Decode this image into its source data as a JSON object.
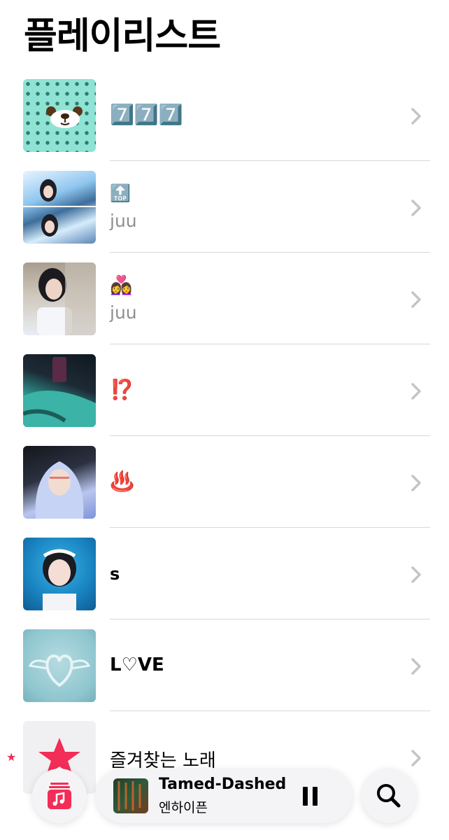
{
  "page_title": "플레이리스트",
  "playlists": [
    {
      "title": "7️⃣7️⃣7️⃣",
      "subtitle": "",
      "thumb": "bear-polka"
    },
    {
      "title": "🔝",
      "subtitle": "juu",
      "thumb": "girl-blue"
    },
    {
      "title": "👩‍❤️‍👩",
      "subtitle": "juu",
      "thumb": "girl-cap"
    },
    {
      "title": "⁉️",
      "subtitle": "",
      "thumb": "green-jacket"
    },
    {
      "title": "♨️",
      "subtitle": "",
      "thumb": "boy-hood"
    },
    {
      "title": "s",
      "subtitle": "",
      "thumb": "girl-pool"
    },
    {
      "title": "L♡VE",
      "subtitle": "",
      "thumb": "heart-plate"
    },
    {
      "title": "즐겨찾는 노래",
      "subtitle": "",
      "thumb": "star"
    }
  ],
  "now_playing": {
    "song": "Tamed-Dashed",
    "artist": "엔하이픈"
  },
  "icons": {
    "library": "music-note-stack-icon",
    "pause": "pause-icon",
    "search": "search-icon",
    "chevron": "chevron-right-icon"
  },
  "colors": {
    "accent": "#f22d57",
    "secondary_text": "#8e8e93"
  }
}
